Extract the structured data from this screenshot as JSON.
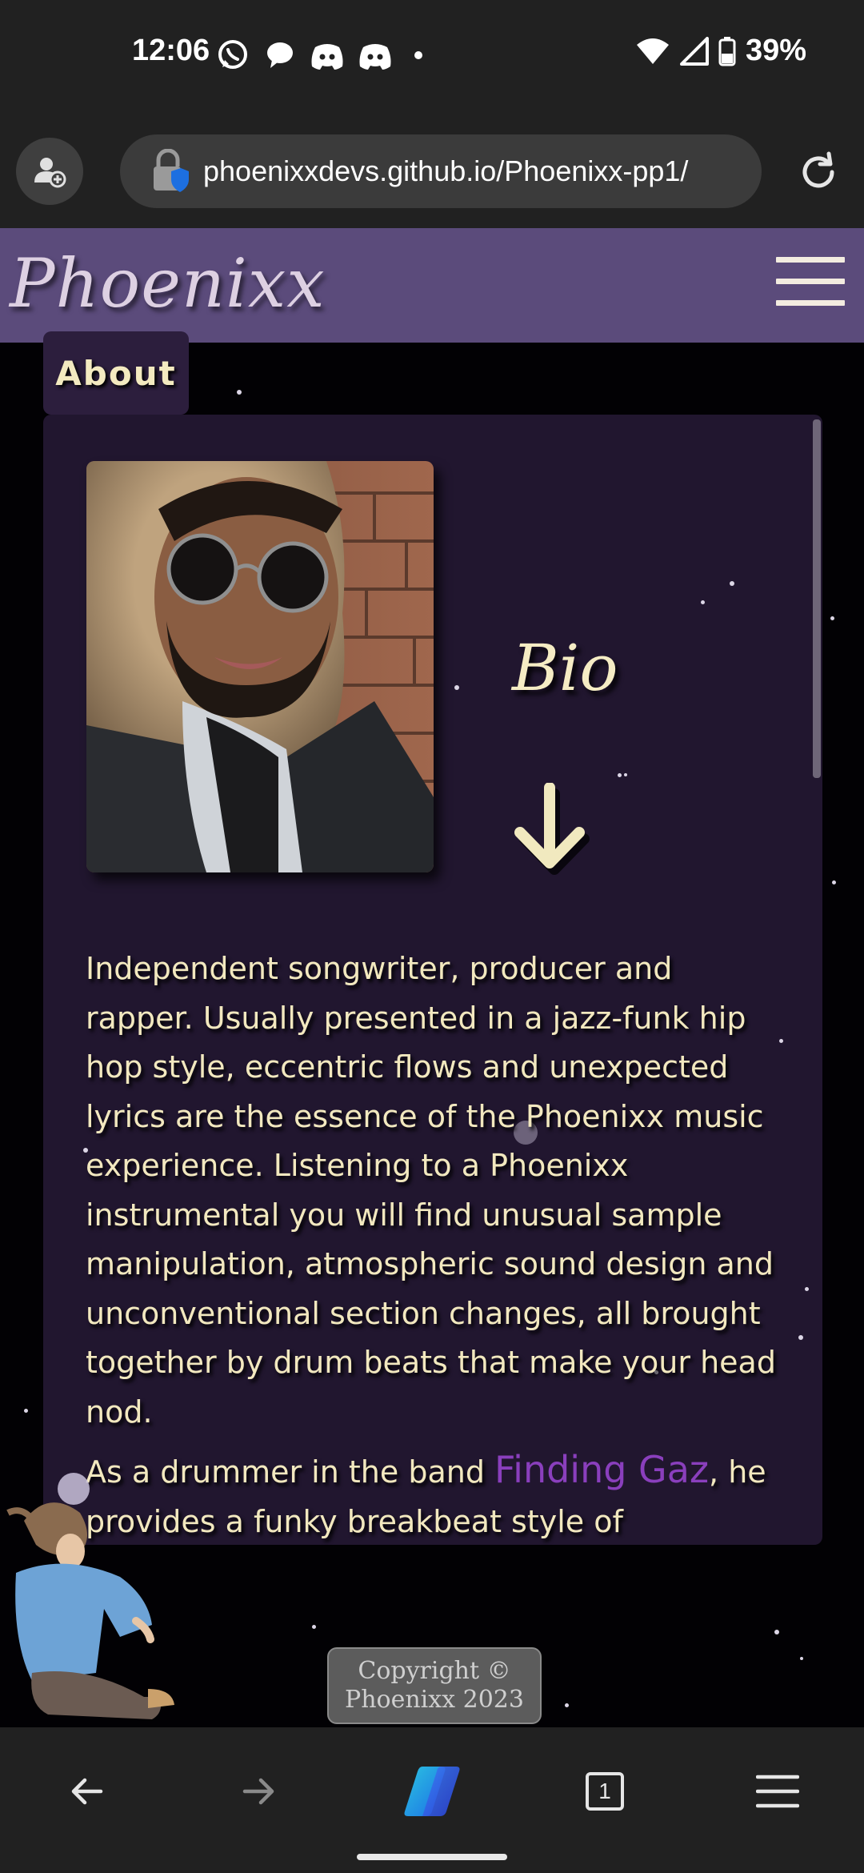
{
  "status_bar": {
    "time": "12:06",
    "battery": "39%",
    "left_icons": [
      "whatsapp-icon",
      "chat-bubble-icon",
      "discord-icon",
      "discord-icon",
      "notification-dot-icon"
    ],
    "right_icons": [
      "wifi-icon",
      "signal-icon",
      "battery-icon"
    ]
  },
  "browser": {
    "url": "phoenixxdevs.github.io/Phoenixx-pp1/",
    "icons": [
      "profile-icon",
      "lock-shield-icon",
      "reload-icon"
    ]
  },
  "site": {
    "logo": "Phoenixx",
    "menu_icon": "hamburger-icon",
    "section_tab": "About",
    "bio_heading": "Bio",
    "bio_para1": "Independent songwriter, producer and rapper. Usually presented in a jazz-funk hip hop style, eccentric flows and unexpected lyrics are the essence of the Phoenixx music experience. Listening to a Phoenixx instrumental you will find unusual sample manipulation, atmospheric sound design and unconventional section changes, all brought together by drum beats that make your head nod.",
    "bio_para2_before": "As a drummer in the band ",
    "band_link": "Finding Gaz",
    "bio_para2_after": ", he provides a funky breakbeat style of drumming that drives the band's syncopated and quirky",
    "copyright_line1": "Copyright ©",
    "copyright_line2": "Phoenixx 2023"
  },
  "bottom_nav": {
    "tab_count": "1",
    "icons": [
      "back-arrow-icon",
      "forward-arrow-icon",
      "copilot-icon",
      "tabs-icon",
      "menu-icon"
    ]
  },
  "colors": {
    "header_bg": "#5b4b7b",
    "card_bg": "#21162f",
    "text_cream": "#f2e8bf",
    "link_purple": "#8a3fbd",
    "browser_chrome": "#212121"
  }
}
